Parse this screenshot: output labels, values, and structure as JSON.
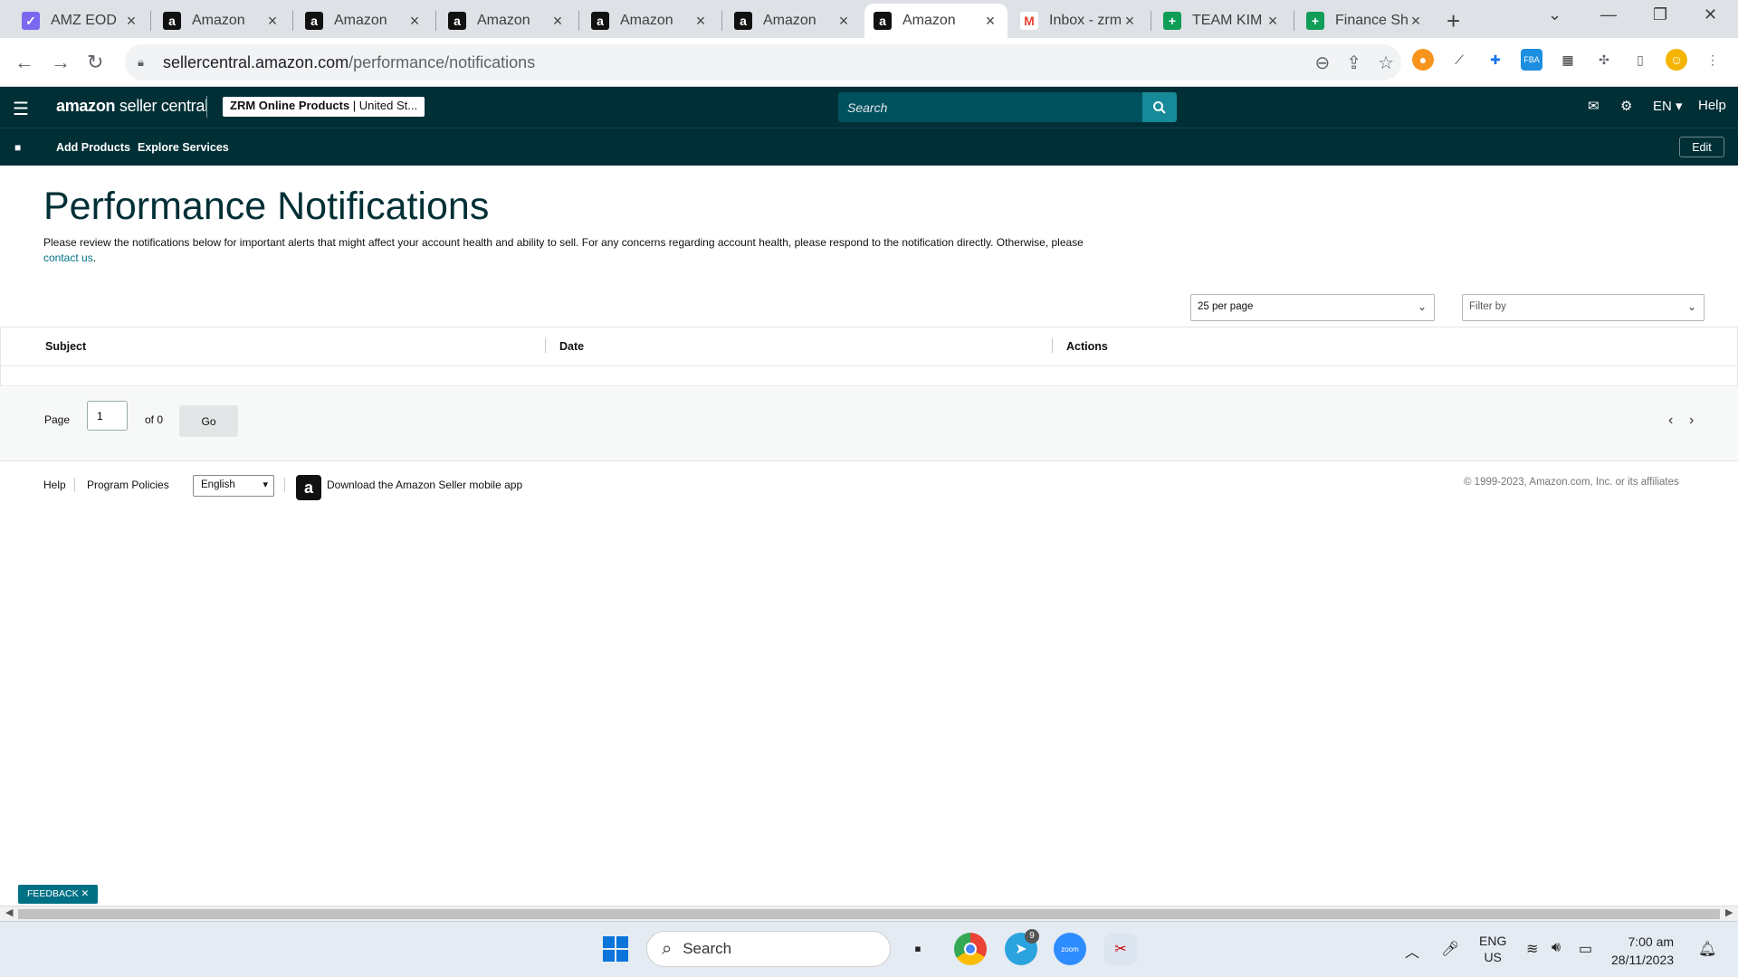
{
  "browser": {
    "tabs": [
      {
        "title": "AMZ EOD",
        "favicon": "clickup-icon",
        "active": false
      },
      {
        "title": "Amazon",
        "favicon": "amazon-icon",
        "active": false
      },
      {
        "title": "Amazon",
        "favicon": "amazon-icon",
        "active": false
      },
      {
        "title": "Amazon",
        "favicon": "amazon-icon",
        "active": false
      },
      {
        "title": "Amazon",
        "favicon": "amazon-icon",
        "active": false
      },
      {
        "title": "Amazon",
        "favicon": "amazon-icon",
        "active": false
      },
      {
        "title": "Amazon",
        "favicon": "amazon-icon",
        "active": true
      },
      {
        "title": "Inbox - zrm",
        "favicon": "gmail-icon",
        "active": false
      },
      {
        "title": "TEAM KIM",
        "favicon": "sheets-icon",
        "active": false
      },
      {
        "title": "Finance Sh",
        "favicon": "sheets-icon",
        "active": false
      }
    ],
    "url_host": "sellercentral.amazon.com",
    "url_path": "/performance/notifications"
  },
  "header": {
    "logo_main": "amazon",
    "logo_sub": "seller central",
    "account_name": "ZRM Online Products",
    "account_region": "United St...",
    "search_placeholder": "Search",
    "language": "EN",
    "help": "Help"
  },
  "subnav": {
    "items": [
      "Add Products",
      "Explore Services"
    ],
    "edit": "Edit"
  },
  "main": {
    "title": "Performance Notifications",
    "intro": "Please review the notifications below for important alerts that might affect your account health and ability to sell. For any concerns regarding account health, please respond to the notification directly. Otherwise, please",
    "contact_link": "contact us",
    "per_page": "25 per page",
    "filter": "Filter by",
    "columns": [
      "Subject",
      "Date",
      "Actions"
    ],
    "pager": {
      "page_label": "Page",
      "page_value": "1",
      "of_label": "of 0",
      "go": "Go"
    }
  },
  "footer": {
    "help": "Help",
    "policies": "Program Policies",
    "language": "English",
    "app_link": "Download the Amazon Seller mobile app",
    "copyright": "© 1999-2023, Amazon.com, Inc. or its affiliates"
  },
  "feedback": "FEEDBACK",
  "taskbar": {
    "search": "Search",
    "lang_top": "ENG",
    "lang_bottom": "US",
    "time": "7:00 am",
    "date": "28/11/2023",
    "telegram_badge": "9"
  }
}
